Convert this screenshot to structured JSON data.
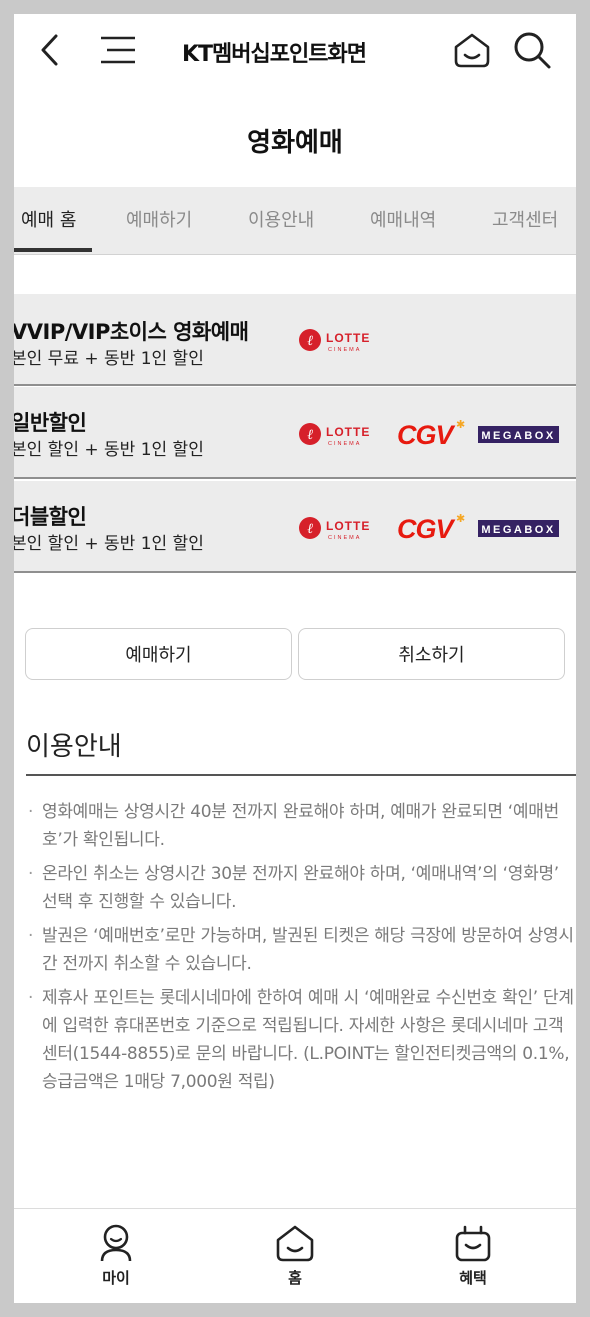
{
  "header": {
    "brand": "KT멤버십포인트화면",
    "page_title": "영화예매",
    "icons": [
      "back-arrow-icon",
      "menu-icon",
      "home-icon",
      "search-icon"
    ]
  },
  "tabs": [
    {
      "label": "예매 홈",
      "active": true
    },
    {
      "label": "예매하기",
      "active": false
    },
    {
      "label": "이용안내",
      "active": false
    },
    {
      "label": "예매내역",
      "active": false
    },
    {
      "label": "고객센터",
      "active": false
    }
  ],
  "benefits": [
    {
      "title": "VVIP/VIP초이스 영화예매",
      "subtitle": "본인 무료 + 동반 1인 할인",
      "partners": [
        "LOTTE CINEMA"
      ]
    },
    {
      "title": "일반할인",
      "subtitle": "본인 할인 + 동반 1인 할인",
      "partners": [
        "LOTTE CINEMA",
        "CGV",
        "MEGABOX"
      ]
    },
    {
      "title": "더블할인",
      "subtitle": "본인 할인 + 동반 1인 할인",
      "partners": [
        "LOTTE CINEMA",
        "CGV",
        "MEGABOX"
      ]
    }
  ],
  "logos": {
    "lotte_word": "LOTTE",
    "lotte_sub": "CINEMA",
    "cgv": "CGV",
    "megabox": "MEGABOX"
  },
  "actions": {
    "reserve": "예매하기",
    "cancel": "취소하기"
  },
  "guide": {
    "title": "이용안내",
    "notes": [
      "영화예매는 상영시간 40분 전까지 완료해야 하며, 예매가 완료되면 ‘예매번호’가 확인됩니다.",
      "온라인 취소는 상영시간 30분 전까지 완료해야 하며, ‘예매내역’의 ‘영화명’ 선택 후 진행할 수 있습니다.",
      "발권은 ‘예매번호’로만 가능하며, 발권된 티켓은 해당 극장에 방문하여 상영시간 전까지 취소할 수 있습니다.",
      "제휴사 포인트는 롯데시네마에 한하여 예매 시 ‘예매완료 수신번호 확인’ 단계에 입력한 휴대폰번호 기준으로 적립됩니다. 자세한 사항은 롯데시네마 고객센터(1544-8855)로 문의 바랍니다. (L.POINT는 할인전티켓금액의 0.1%, 승급금액은 1매당 7,000원 적립)"
    ]
  },
  "bottom_nav": [
    {
      "label": "마이",
      "icon": "person-icon"
    },
    {
      "label": "홈",
      "icon": "home-icon"
    },
    {
      "label": "혜택",
      "icon": "gift-bag-icon"
    }
  ],
  "colors": {
    "lotte_red": "#d6202a",
    "cgv_red": "#e71a0f",
    "megabox_purple": "#352263",
    "band_gray": "#ececec"
  }
}
